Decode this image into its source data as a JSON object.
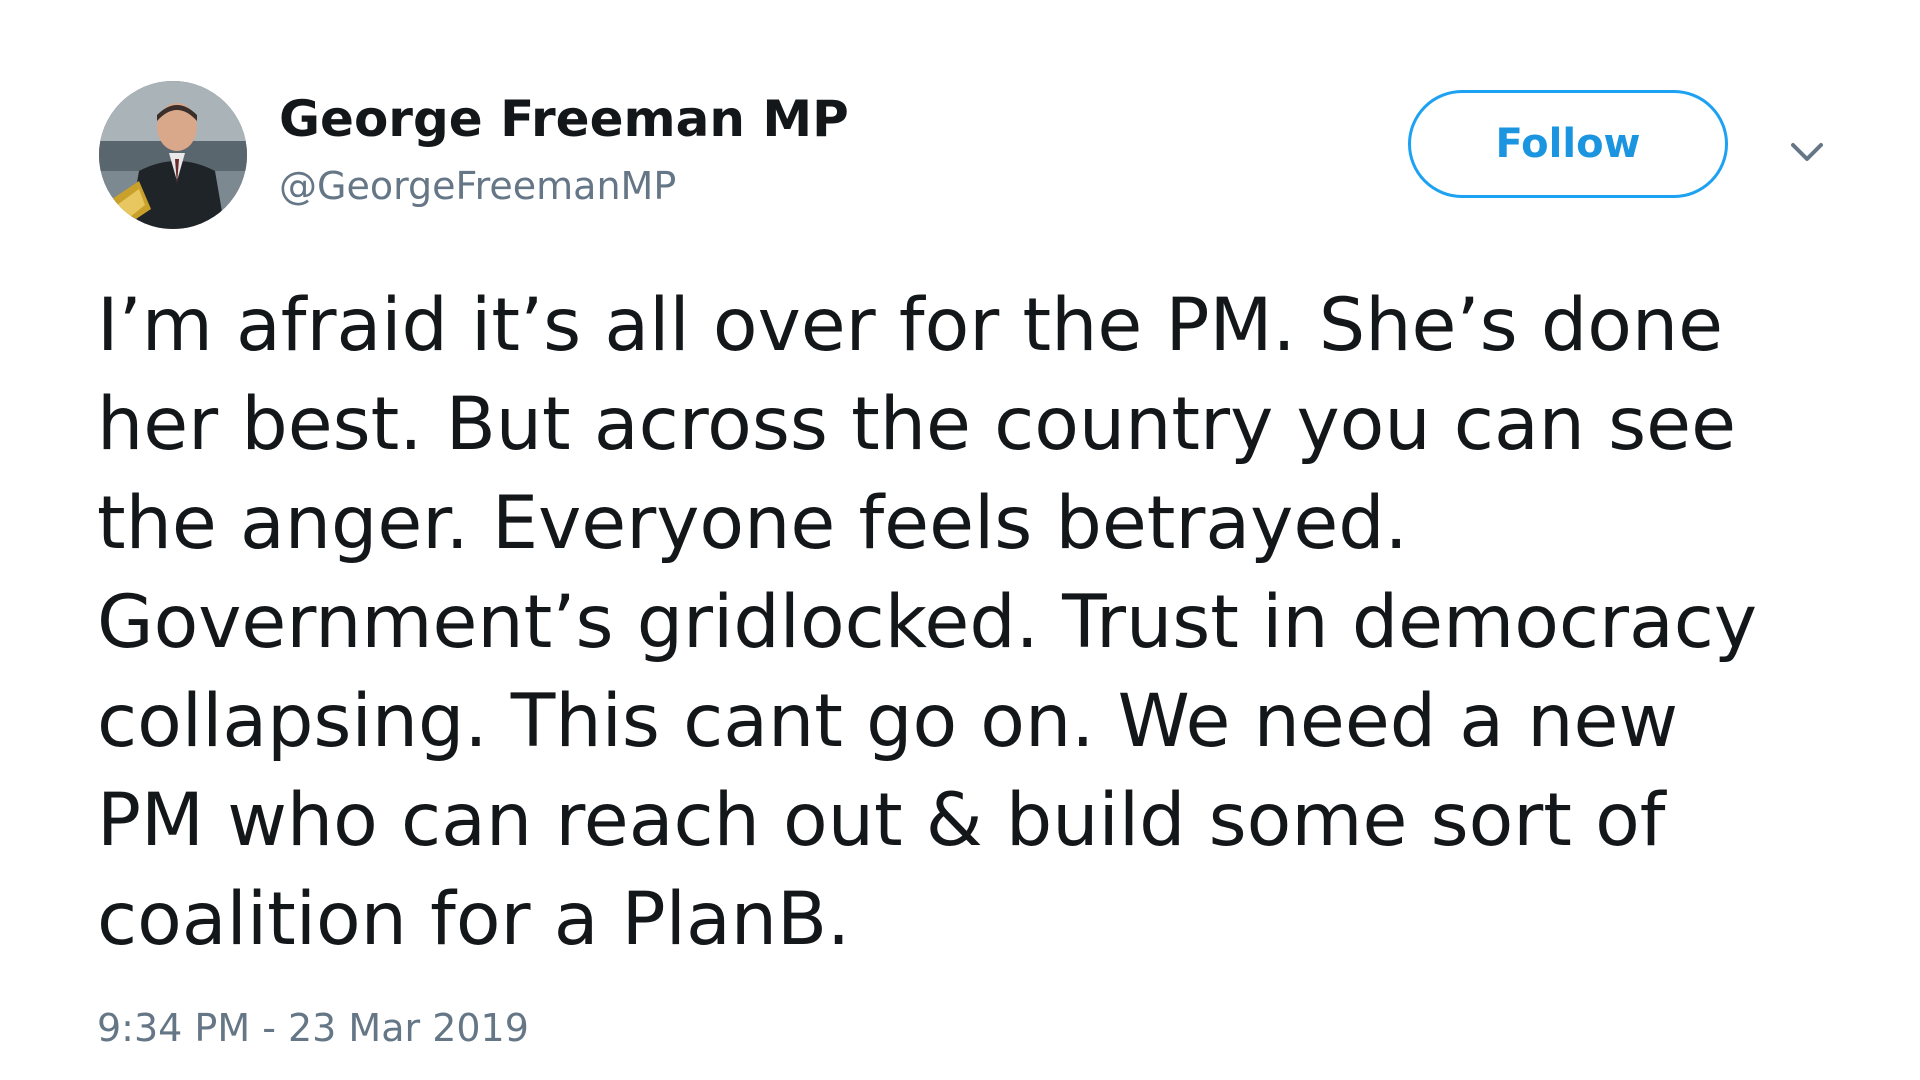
{
  "user": {
    "display_name": "George Freeman MP",
    "handle": "@GeorgeFreemanMP",
    "avatar_icon": "profile-photo"
  },
  "actions": {
    "follow_label": "Follow",
    "menu_icon": "chevron-down-icon"
  },
  "tweet": {
    "lines": [
      "I’m afraid it’s all over for the PM. She’s done",
      "her best. But across the country you can see",
      "the anger. Everyone feels betrayed.",
      "Government’s gridlocked. Trust in democracy",
      "collapsing. This cant go on. We need a new",
      "PM who can reach out & build some sort of",
      "coalition for a PlanB."
    ],
    "timestamp": "9:34 PM - 23 Mar 2019"
  },
  "colors": {
    "accent": "#1da1f2",
    "text": "#14171a",
    "secondary": "#657786"
  }
}
